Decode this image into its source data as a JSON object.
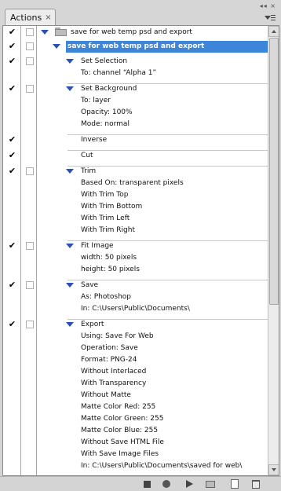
{
  "panel": {
    "tab_label": "Actions",
    "tab_close": "×",
    "top_controls": "◂◂ ×"
  },
  "icons": {
    "checkmark": "✔",
    "expand": "twirl-down-icon",
    "folder": "folder-icon"
  },
  "actions": {
    "set_name": "save for web temp psd and export",
    "action_name": "save for web temp psd and export",
    "steps": [
      {
        "title": "Set Selection",
        "params": [
          "To: channel “Alpha 1”"
        ],
        "checked": true,
        "dialog": true,
        "expandable": true
      },
      {
        "title": "Set Background",
        "params": [
          "To: layer",
          "Opacity: 100%",
          "Mode: normal"
        ],
        "checked": true,
        "dialog": true,
        "expandable": true
      },
      {
        "title": "Inverse",
        "params": [],
        "checked": true,
        "dialog": false,
        "expandable": false
      },
      {
        "title": "Cut",
        "params": [],
        "checked": true,
        "dialog": false,
        "expandable": false
      },
      {
        "title": "Trim",
        "params": [
          "Based On: transparent pixels",
          "With Trim Top",
          "With Trim Bottom",
          "With Trim Left",
          "With Trim Right"
        ],
        "checked": true,
        "dialog": true,
        "expandable": true
      },
      {
        "title": "Fit Image",
        "params": [
          "width: 50 pixels",
          "height: 50 pixels"
        ],
        "checked": true,
        "dialog": true,
        "expandable": true
      },
      {
        "title": "Save",
        "params": [
          "As: Photoshop",
          "In: C:\\Users\\Public\\Documents\\"
        ],
        "checked": true,
        "dialog": true,
        "expandable": true
      },
      {
        "title": "Export",
        "params": [
          "Using: Save For Web",
          "Operation: Save",
          "Format: PNG-24",
          "Without Interlaced",
          "With Transparency",
          "Without Matte",
          "Matte Color Red: 255",
          "Matte Color Green: 255",
          "Matte Color Blue: 255",
          "Without Save HTML File",
          "With Save Image Files",
          "In: C:\\Users\\Public\\Documents\\saved for web\\"
        ],
        "checked": true,
        "dialog": true,
        "expandable": true
      }
    ]
  },
  "footer": {
    "buttons": [
      "stop-icon",
      "record-icon",
      "play-icon",
      "new-set-icon",
      "new-action-icon",
      "delete-icon"
    ]
  },
  "colors": {
    "selection": "#3d85d8",
    "twirl": "#2b4fb8"
  }
}
